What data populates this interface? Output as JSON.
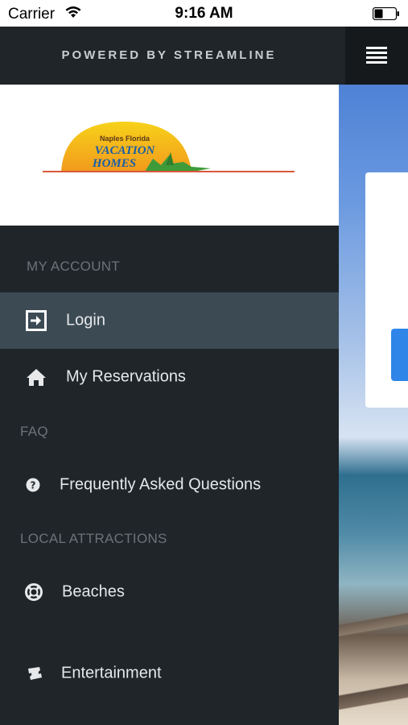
{
  "status_bar": {
    "carrier": "Carrier",
    "time": "9:16 AM"
  },
  "header": {
    "powered_by": "POWERED BY STREAMLINE",
    "menu_icon": "hamburger-icon"
  },
  "logo": {
    "line1": "Naples Florida",
    "line2": "VACATION",
    "line3": "HOMES"
  },
  "drawer": {
    "sections": [
      {
        "title": "MY ACCOUNT",
        "items": [
          {
            "label": "Login",
            "icon": "login-icon",
            "active": true
          },
          {
            "label": "My Reservations",
            "icon": "home-icon",
            "active": false
          }
        ]
      },
      {
        "title": "FAQ",
        "items": [
          {
            "label": "Frequently Asked Questions",
            "icon": "question-icon",
            "active": false
          }
        ]
      },
      {
        "title": "LOCAL ATTRACTIONS",
        "items": [
          {
            "label": "Beaches",
            "icon": "lifebuoy-icon",
            "active": false
          },
          {
            "label": "Entertainment",
            "icon": "ticket-icon",
            "active": false
          }
        ]
      }
    ]
  },
  "colors": {
    "drawer_bg": "#1f2529",
    "active_item_bg": "#3c4a54",
    "section_text": "#6c7378",
    "item_text": "#e6e8ea",
    "accent_blue": "#2f86e8"
  }
}
